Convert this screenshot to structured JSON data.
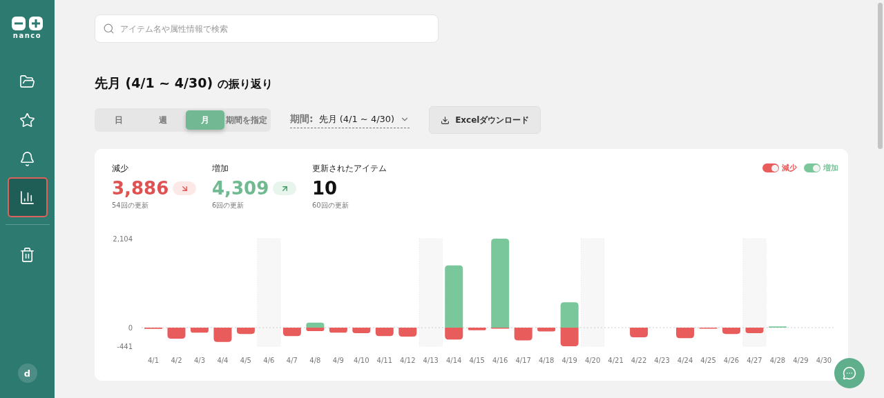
{
  "sidebar": {
    "logo": "nanco",
    "items": [
      {
        "selected": false
      },
      {
        "selected": false
      },
      {
        "selected": false
      },
      {
        "selected": true
      },
      {
        "selected": false
      }
    ],
    "avatar": "d"
  },
  "search": {
    "placeholder": "アイテム名や属性情報で検索"
  },
  "heading": {
    "title": "先月 (4/1 ~ 4/30)",
    "suffix": "の振り返り"
  },
  "period_tabs": [
    {
      "label": "日",
      "selected": false
    },
    {
      "label": "週",
      "selected": false
    },
    {
      "label": "月",
      "selected": true
    },
    {
      "label": "期間を指定",
      "selected": false
    }
  ],
  "period_select": {
    "label": "期間:",
    "value": "先月 (4/1 ~ 4/30)"
  },
  "download_button": "Excelダウンロード",
  "stats": [
    {
      "kind": "down",
      "label": "減少",
      "value": "3,886",
      "sub": "54回の更新"
    },
    {
      "kind": "up",
      "label": "増加",
      "value": "4,309",
      "sub": "6回の更新"
    },
    {
      "kind": "plain",
      "label": "更新されたアイテム",
      "value": "10",
      "sub": "60回の更新"
    }
  ],
  "legend": [
    {
      "on": true
    },
    {
      "on": true
    }
  ],
  "chart_days": [
    {
      "shaded": false
    },
    {
      "shaded": false
    },
    {
      "shaded": false
    },
    {
      "shaded": false
    },
    {
      "shaded": false
    },
    {
      "shaded": true
    },
    {
      "shaded": false
    },
    {
      "shaded": false
    },
    {
      "shaded": false
    },
    {
      "shaded": false
    },
    {
      "shaded": false
    },
    {
      "shaded": false
    },
    {
      "shaded": true
    },
    {
      "shaded": false
    },
    {
      "shaded": false
    },
    {
      "shaded": false
    },
    {
      "shaded": false
    },
    {
      "shaded": false
    },
    {
      "shaded": false
    },
    {
      "shaded": true
    },
    {
      "shaded": false
    },
    {
      "shaded": false
    },
    {
      "shaded": false
    },
    {
      "shaded": false
    },
    {
      "shaded": false
    },
    {
      "shaded": false
    },
    {
      "shaded": true
    },
    {
      "shaded": false
    },
    {
      "shaded": false
    },
    {
      "shaded": false
    }
  ],
  "chart_data": {
    "type": "bar",
    "categories": [
      "4/1",
      "4/2",
      "4/3",
      "4/4",
      "4/5",
      "4/6",
      "4/7",
      "4/8",
      "4/9",
      "4/10",
      "4/11",
      "4/12",
      "4/13",
      "4/14",
      "4/15",
      "4/16",
      "4/17",
      "4/18",
      "4/19",
      "4/20",
      "4/21",
      "4/22",
      "4/23",
      "4/24",
      "4/25",
      "4/26",
      "4/27",
      "4/28",
      "4/29",
      "4/30"
    ],
    "series": [
      {
        "name": "減少",
        "color": "#e85c5c",
        "values": [
          -30,
          -260,
          -120,
          -340,
          -150,
          0,
          -200,
          -80,
          -120,
          -130,
          -200,
          -210,
          0,
          -280,
          -60,
          -10,
          -300,
          -90,
          -441,
          0,
          0,
          -230,
          0,
          -250,
          -10,
          -150,
          -130,
          0,
          0,
          0
        ]
      },
      {
        "name": "増加",
        "color": "#7ac79b",
        "values": [
          0,
          0,
          0,
          0,
          0,
          0,
          0,
          120,
          0,
          0,
          0,
          0,
          0,
          1470,
          0,
          2104,
          0,
          0,
          600,
          0,
          0,
          0,
          0,
          0,
          0,
          0,
          0,
          30,
          0,
          0
        ]
      }
    ],
    "ylim": [
      -441,
      2104
    ],
    "yticks": [
      {
        "value": 2104,
        "label": "2,104"
      },
      0,
      {
        "value": -441,
        "label": "-441"
      }
    ]
  }
}
